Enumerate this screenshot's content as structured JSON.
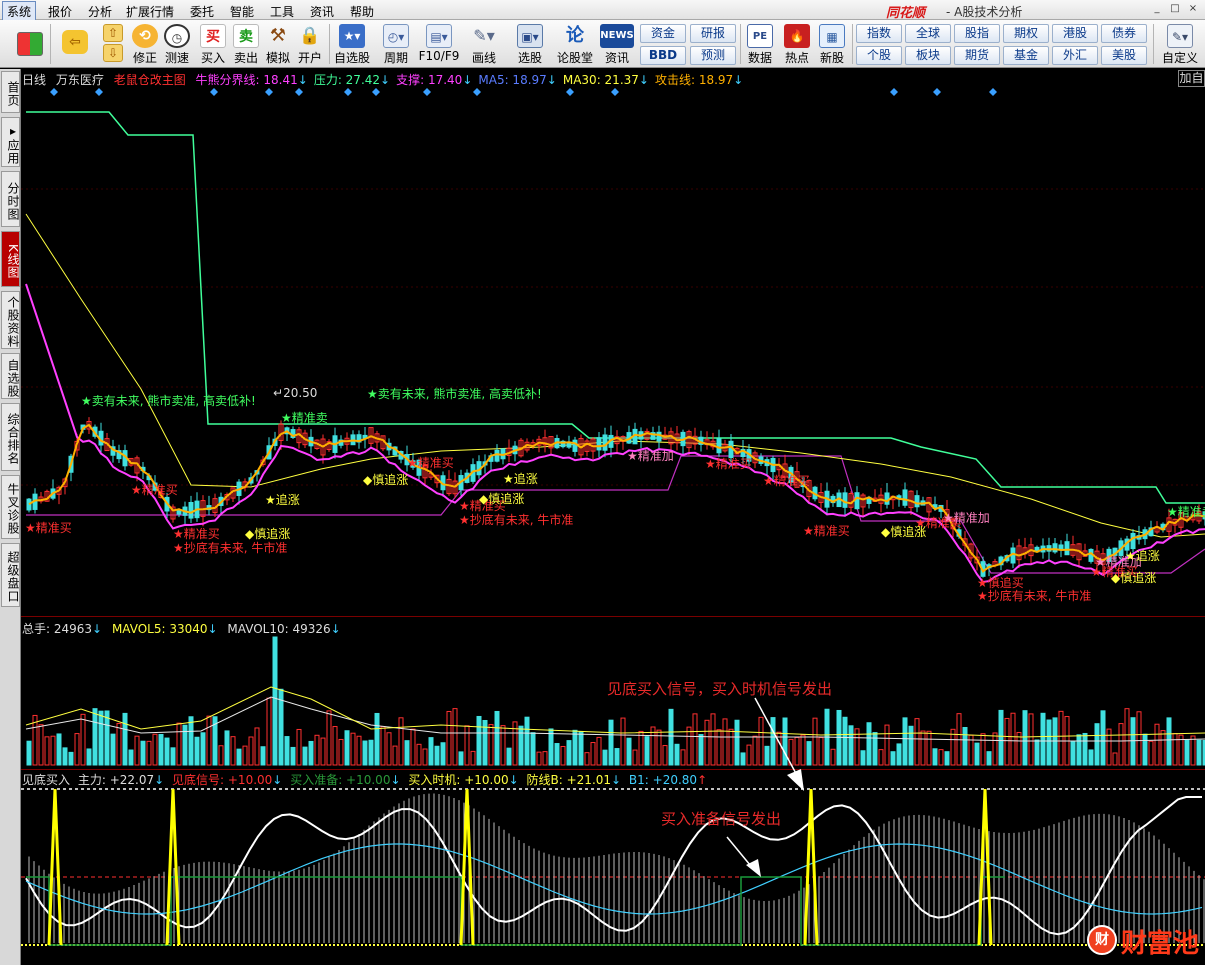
{
  "menubar": {
    "items": [
      "系统",
      "报价",
      "分析",
      "扩展行情",
      "委托",
      "智能",
      "工具",
      "资讯",
      "帮助"
    ],
    "brand": "同花顺",
    "subtitle": "- A股技术分析"
  },
  "toolbar": {
    "buttons": [
      "修正",
      "测速",
      "买入",
      "卖出",
      "模拟",
      "开户",
      "自选股",
      "周期",
      "F10/F9",
      "画线",
      "选股",
      "论股堂",
      "资讯",
      "数据",
      "热点",
      "新股",
      "自定义"
    ],
    "icon_glyphs": {
      "buy": "买",
      "sell": "卖",
      "news": "NEWS"
    },
    "grid_left": [
      "资金",
      "研报",
      "BBD",
      "预测"
    ],
    "grid_right": [
      "指数",
      "全球",
      "股指",
      "期权",
      "港股",
      "债券",
      "个股",
      "板块",
      "期货",
      "基金",
      "外汇",
      "美股"
    ]
  },
  "left_tabs": [
    "首页",
    "应用",
    "分时图",
    "K线图",
    "个股资料",
    "自选股",
    "综合排名",
    "牛叉诊股",
    "超级盘口"
  ],
  "main_header": {
    "period": "日线",
    "stock": "万东医疗",
    "indicator": "老鼠仓改主图",
    "items": [
      {
        "label": "牛熊分界线: 18.41",
        "arrow": "↓",
        "color": "#ff40ff"
      },
      {
        "label": "压力: 27.42",
        "arrow": "↓",
        "color": "#40ff9a"
      },
      {
        "label": "支撑: 17.40",
        "arrow": "↓",
        "color": "#ff40ff"
      },
      {
        "label": "MA5: 18.97",
        "arrow": "↓",
        "color": "#5a7cff"
      },
      {
        "label": "MA30: 21.37",
        "arrow": "↓",
        "color": "#ffff40"
      },
      {
        "label": "攻击线: 18.97",
        "arrow": "↓",
        "color": "#ffb000"
      }
    ],
    "add_button": "加自"
  },
  "price_marker": "20.50",
  "annotations": {
    "sell_top": "卖有未来, 熊市卖准, 高卖低补!",
    "precise_sell": "精准卖",
    "precise_buy": "精准买",
    "precise_add": "精准加",
    "bottom_buy": "抄底有未来, 牛市准",
    "chase": "追涨",
    "careful_chase": "慎追涨",
    "careful_buy": "慎追买"
  },
  "volume_header": {
    "total": "总手: 24963",
    "mavol5": "MAVOL5: 33040",
    "mavol10": "MAVOL10: 49326"
  },
  "indicator_header": {
    "name": "见底买入",
    "main": "主力: +22.07",
    "signal": "见底信号: +10.00",
    "prepare": "买入准备: +10.00",
    "timing": "买入时机: +10.00",
    "defense": "防线B: +21.01",
    "b1": "B1: +20.80"
  },
  "callouts": {
    "bottom_signal": "见底买入信号，买入时机信号发出",
    "prepare_signal": "买入准备信号发出"
  },
  "watermark": "财富池",
  "colors": {
    "up": "#ff3030",
    "down": "#40e0e0",
    "pressure": "#40ff9a",
    "bull_bear": "#ff40ff",
    "attack": "#ffb000",
    "ma30": "#ffff40"
  }
}
